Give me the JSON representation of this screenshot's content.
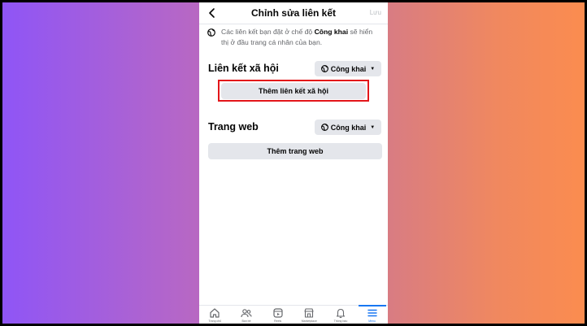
{
  "header": {
    "title": "Chỉnh sửa liên kết",
    "save_label": "Lưu"
  },
  "notice": {
    "text_before": "Các liên kết bạn đặt ở chế độ ",
    "text_bold": "Công khai",
    "text_after": " sẽ hiển thị ở đầu trang cá nhân của bạn."
  },
  "social_links": {
    "title": "Liên kết xã hội",
    "privacy_label": "Công khai",
    "add_button_label": "Thêm liên kết xã hội"
  },
  "websites": {
    "title": "Trang web",
    "privacy_label": "Công khai",
    "add_button_label": "Thêm trang web"
  },
  "tabbar": {
    "items": [
      {
        "label": "Trang chủ",
        "icon": "home-icon"
      },
      {
        "label": "Bạn bè",
        "icon": "friends-icon"
      },
      {
        "label": "Reels",
        "icon": "reels-icon"
      },
      {
        "label": "Marketplace",
        "icon": "marketplace-icon"
      },
      {
        "label": "Thông báo",
        "icon": "bell-icon"
      },
      {
        "label": "Menu",
        "icon": "menu-icon"
      }
    ]
  },
  "colors": {
    "accent": "#1877f2",
    "highlight": "#e3161a",
    "button_bg": "#e4e6eb"
  }
}
